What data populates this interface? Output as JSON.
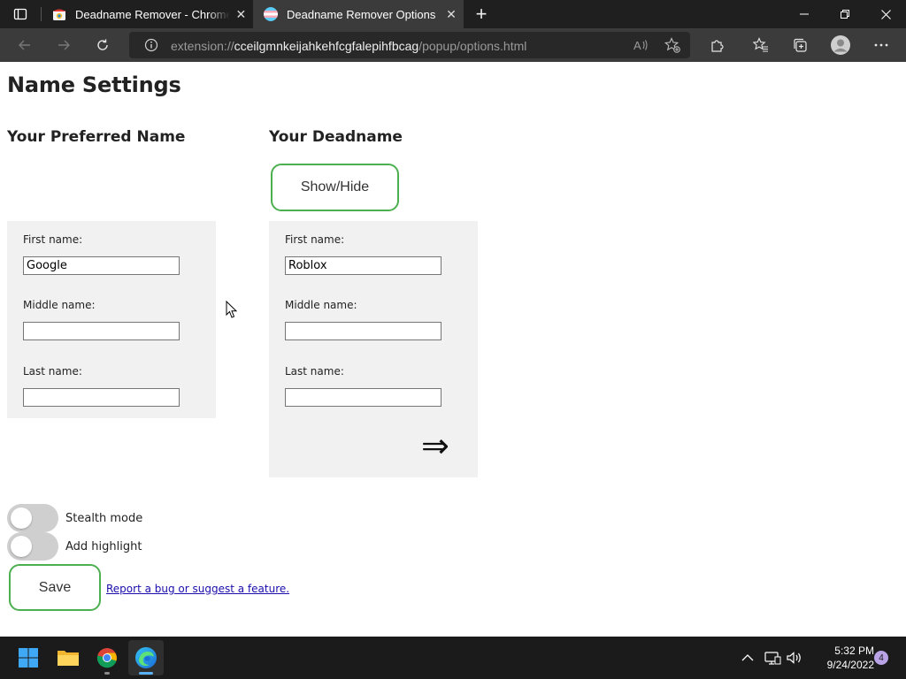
{
  "browser": {
    "tabs": [
      {
        "title": "Deadname Remover - Chrome W",
        "active": false,
        "favicon": "chrome-web-store-icon"
      },
      {
        "title": "Deadname Remover Options",
        "active": true,
        "favicon": "trans-flag-icon"
      }
    ],
    "address": {
      "scheme": "extension://",
      "host": "cceilgmnkeijahkehfcgfalepihfbcag",
      "path": "/popup/options.html"
    }
  },
  "page": {
    "title": "Name Settings",
    "preferred": {
      "heading": "Your Preferred Name",
      "first_label": "First name:",
      "first_value": "Google",
      "middle_label": "Middle name:",
      "middle_value": "",
      "last_label": "Last name:",
      "last_value": ""
    },
    "deadname": {
      "heading": "Your Deadname",
      "toggle_button": "Show/Hide",
      "first_label": "First name:",
      "first_value": "Roblox",
      "middle_label": "Middle name:",
      "middle_value": "",
      "last_label": "Last name:",
      "last_value": "",
      "arrow": "⇒"
    },
    "options": {
      "stealth_label": "Stealth mode",
      "stealth_on": false,
      "highlight_label": "Add highlight",
      "highlight_on": false
    },
    "save_label": "Save",
    "report_link": "Report a bug or suggest a feature."
  },
  "taskbar": {
    "apps": [
      "start-icon",
      "file-explorer-icon",
      "chrome-icon",
      "edge-icon"
    ],
    "time": "5:32 PM",
    "date": "9/24/2022",
    "notification_count": "4"
  },
  "colors": {
    "accent_green": "#4caf50",
    "panel_bg": "#f1f1f1",
    "link": "#1a0dab",
    "titlebar": "#1f1f1f",
    "toolbar": "#3b3b3b"
  }
}
